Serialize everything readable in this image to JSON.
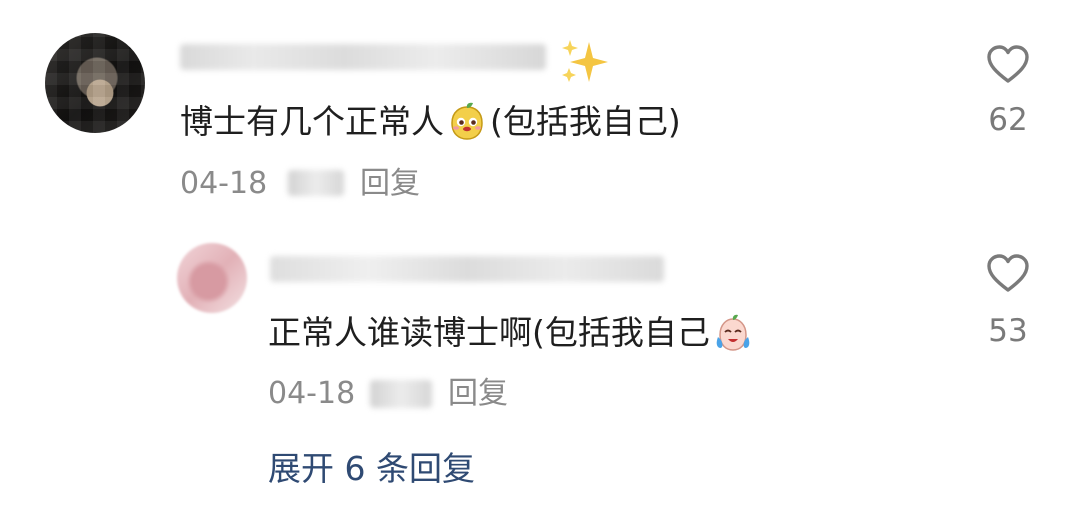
{
  "comment": {
    "text_before_emoji": "博士有几个正常人",
    "text_after_emoji": "(包括我自己)",
    "date": "04-18",
    "reply_label": "回复",
    "like_count": "62",
    "emoji_icon": "fruit-face-emoji",
    "decoration_icon": "sparkles-icon"
  },
  "reply": {
    "text_before_emoji": "正常人谁读博士啊(包括我自己",
    "date": "04-18",
    "reply_label": "回复",
    "like_count": "53",
    "emoji_icon": "crying-face-emoji"
  },
  "expand_replies": {
    "label": "展开 6 条回复"
  },
  "colors": {
    "text": "#1f1f1f",
    "meta": "#8a8a8a",
    "link": "#2f4a73",
    "icon": "#7a7a7a"
  }
}
